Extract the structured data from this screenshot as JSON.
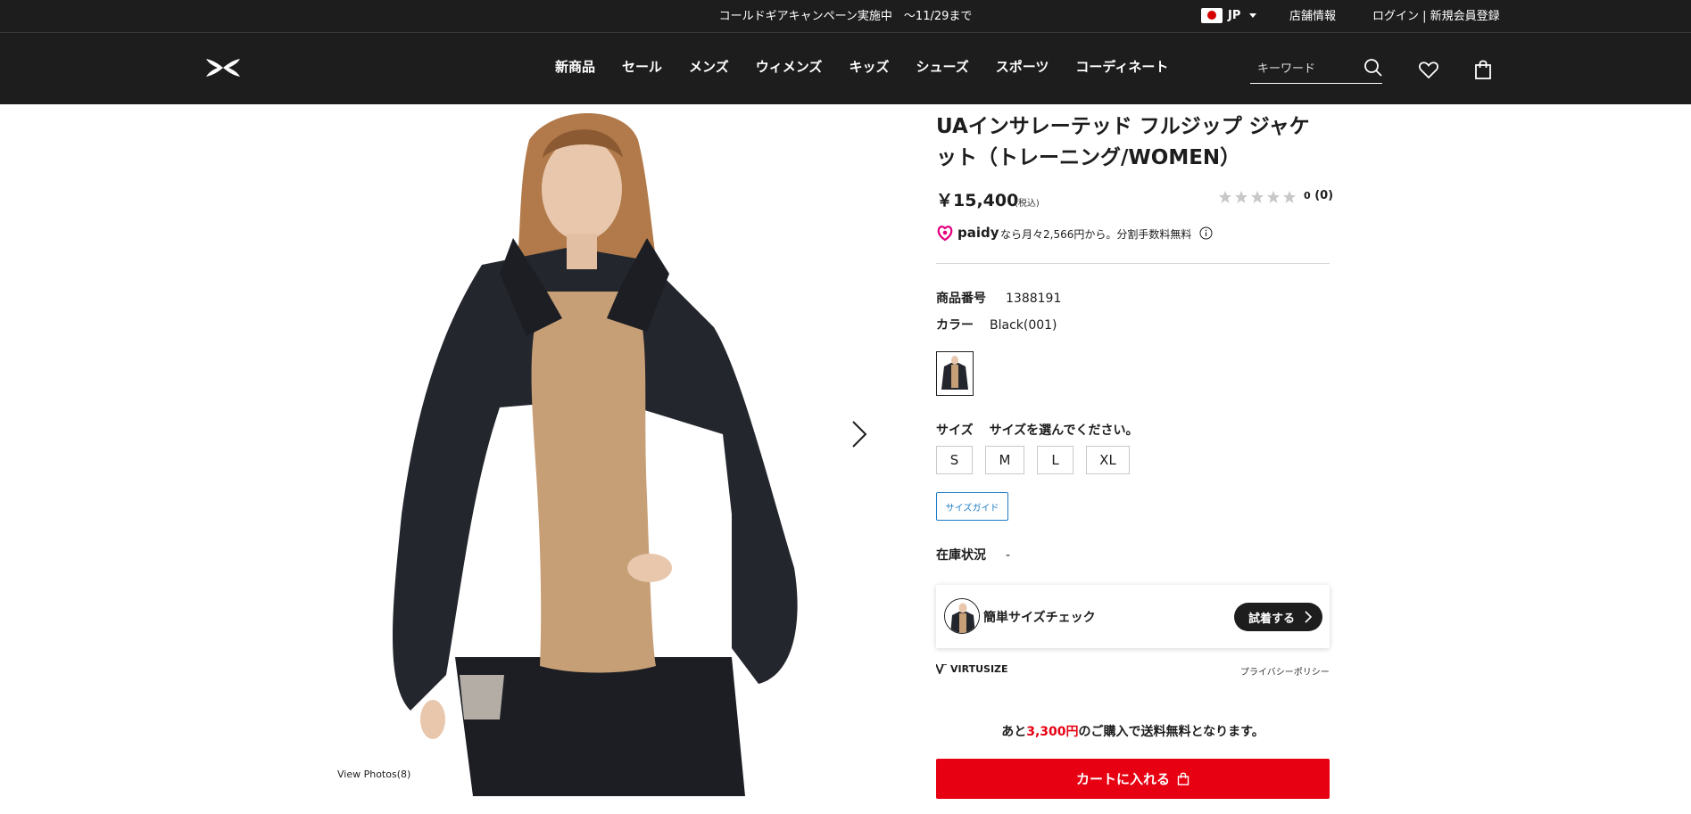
{
  "announcement": {
    "text": "コールドギアキャンペーン実施中　〜11/29まで"
  },
  "utility": {
    "region": "JP",
    "store_info": "店舗情報",
    "login": "ログイン | 新規会員登録"
  },
  "nav": {
    "items": [
      "新商品",
      "セール",
      "メンズ",
      "ウィメンズ",
      "キッズ",
      "シューズ",
      "スポーツ",
      "コーディネート"
    ]
  },
  "search": {
    "placeholder": "キーワード"
  },
  "gallery": {
    "view_photos": "View Photos(8)"
  },
  "product": {
    "title": "UAインサレーテッド フルジップ ジャケット（トレーニング/WOMEN）",
    "price": "￥15,400",
    "tax_note": "(税込)",
    "rating_text": "0",
    "review_count": "(0)",
    "rating_value": 0,
    "paidy_brand": "paidy",
    "paidy_text": "なら月々2,566円から。分割手数料無料",
    "sku_label": "商品番号",
    "sku": "1388191",
    "color_label": "カラー",
    "color": "Black(001)",
    "size_label": "サイズ",
    "size_prompt": "サイズを選んでください。",
    "sizes": [
      "S",
      "M",
      "L",
      "XL"
    ],
    "size_guide": "サイズガイド",
    "stock_label": "在庫状況",
    "stock_value": "-"
  },
  "virtusize": {
    "label": "簡単サイズチェック",
    "button": "試着する",
    "brand": "VIRTUSIZE",
    "privacy": "プライバシーポリシー"
  },
  "shipping": {
    "prefix": "あと",
    "amount": "3,300円",
    "suffix": "のご購入で送料無料となります。"
  },
  "cart": {
    "button": "カートに入れる"
  },
  "colors": {
    "brand_red": "#e60012",
    "header_bg": "#1d1d1d",
    "link_blue": "#1b7ac4",
    "paidy_pink": "#e5007f"
  }
}
